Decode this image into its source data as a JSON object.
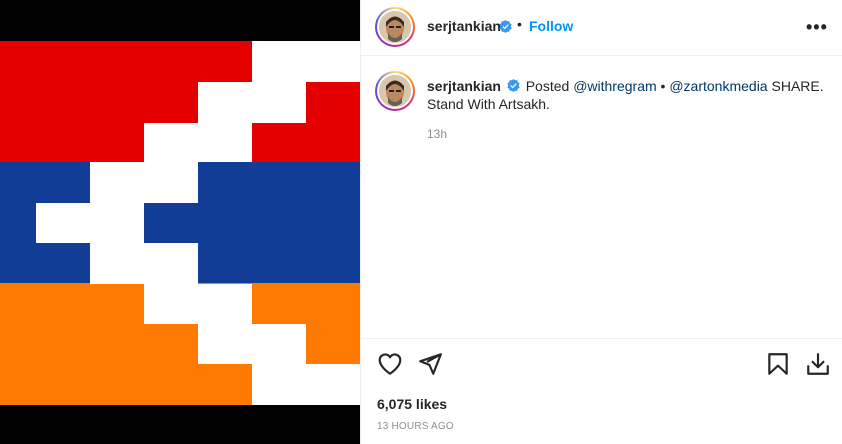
{
  "post": {
    "media_alt": "",
    "flag_colors": {
      "red": "#e50000",
      "blue": "#123d96",
      "orange": "#ff7a00",
      "white": "#ffffff"
    }
  },
  "header": {
    "username": "serjtankian",
    "separator": "•",
    "follow_label": "Follow",
    "more_label": "•••"
  },
  "caption": {
    "username": "serjtankian",
    "text_before": "Posted ",
    "mention1": "@withregram",
    "middle": " • ",
    "mention2": "@zartonkmedia",
    "text_after": " SHARE. Stand With Artsakh.",
    "time": "13h"
  },
  "footer": {
    "likes": "6,075 likes",
    "posted_ago": "13 HOURS AGO",
    "icons": [
      "heart-icon",
      "share-icon",
      "bookmark-icon",
      "download-icon"
    ]
  }
}
